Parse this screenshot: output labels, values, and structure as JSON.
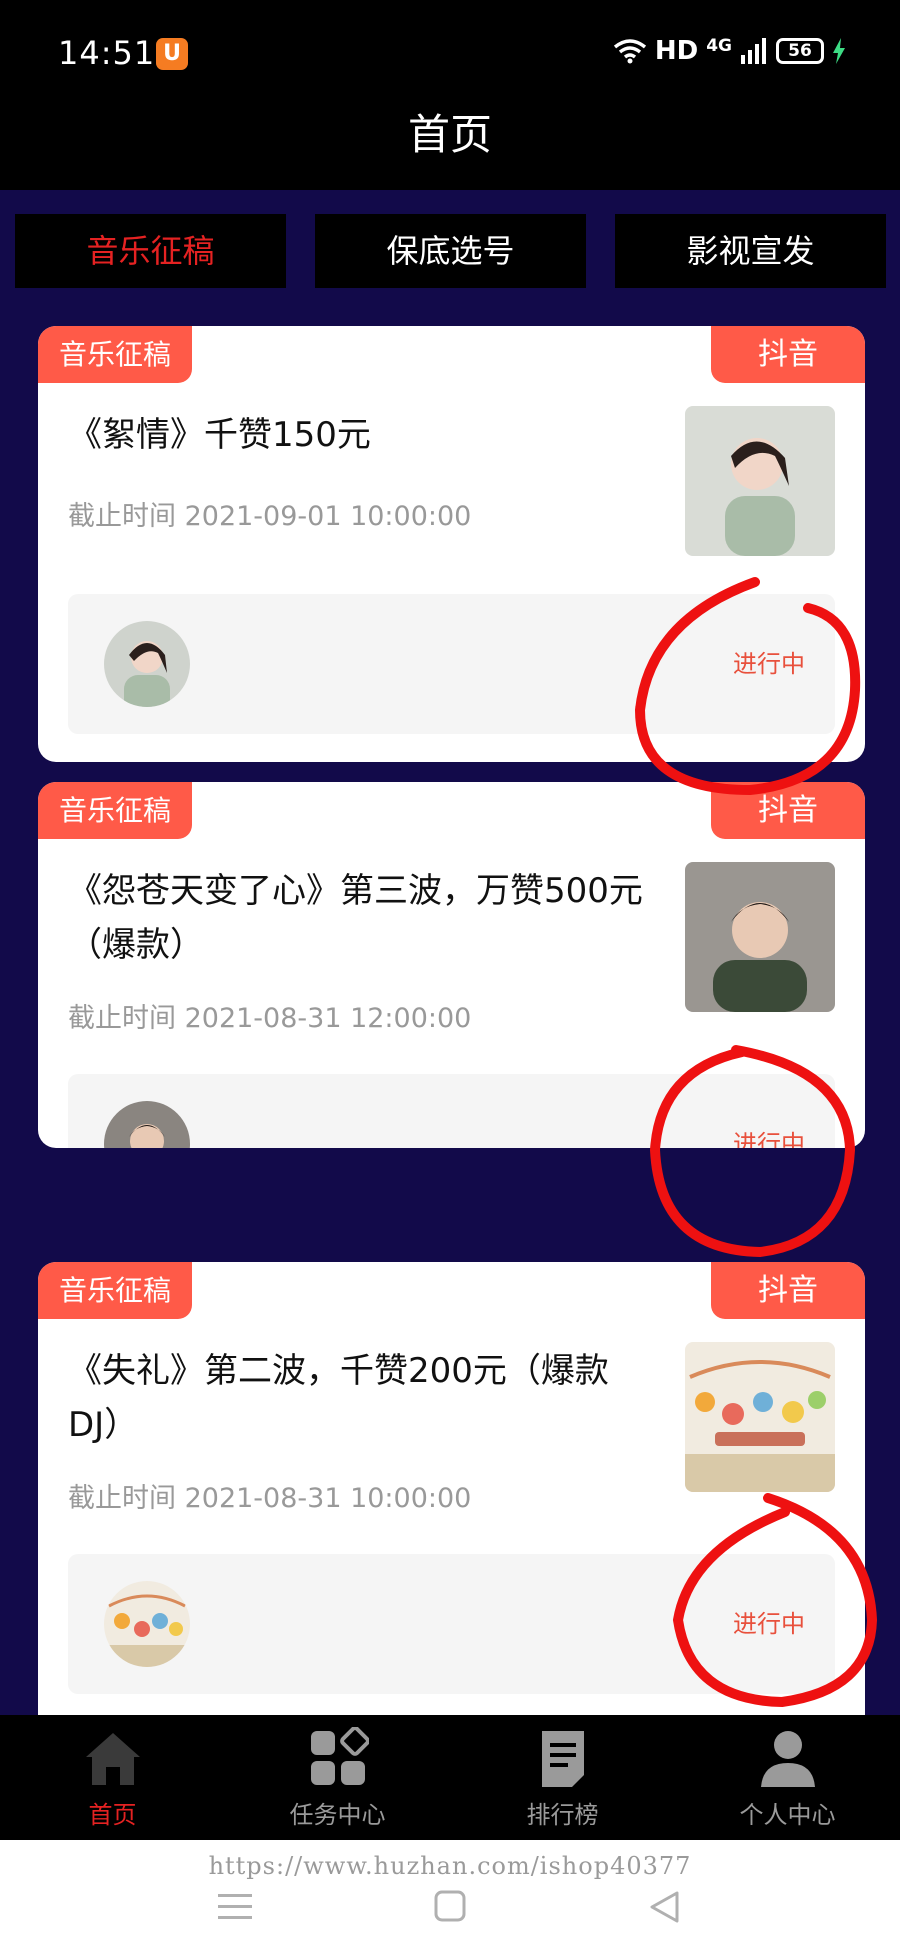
{
  "status_bar": {
    "time": "14:51",
    "hd": "HD",
    "network": "4G",
    "battery": "56"
  },
  "header": {
    "title": "首页"
  },
  "tabs": [
    {
      "label": "音乐征稿",
      "active": true
    },
    {
      "label": "保底选号",
      "active": false
    },
    {
      "label": "影视宣发",
      "active": false
    }
  ],
  "cards": [
    {
      "category": "音乐征稿",
      "platform": "抖音",
      "title": "《絮情》千赞150元",
      "deadline": "截止时间 2021-09-01 10:00:00",
      "status": "进行中"
    },
    {
      "category": "音乐征稿",
      "platform": "抖音",
      "title": "《怨苍天变了心》第三波，万赞500元（爆款）",
      "deadline": "截止时间 2021-08-31 12:00:00",
      "status": "进行中"
    },
    {
      "category": "音乐征稿",
      "platform": "抖音",
      "title": "《失礼》第二波，千赞200元（爆款DJ）",
      "deadline": "截止时间 2021-08-31 10:00:00",
      "status": "进行中"
    }
  ],
  "tabbar": [
    {
      "label": "首页",
      "icon": "home-icon",
      "active": true
    },
    {
      "label": "任务中心",
      "icon": "grid-icon",
      "active": false
    },
    {
      "label": "排行榜",
      "icon": "document-icon",
      "active": false
    },
    {
      "label": "个人中心",
      "icon": "person-icon",
      "active": false
    }
  ],
  "watermark": "https://www.huzhan.com/ishop40377",
  "colors": {
    "accent": "#ff5a48",
    "active_red": "#e52222",
    "main_bg": "#120a4a",
    "annotation_red": "#ee1111"
  }
}
